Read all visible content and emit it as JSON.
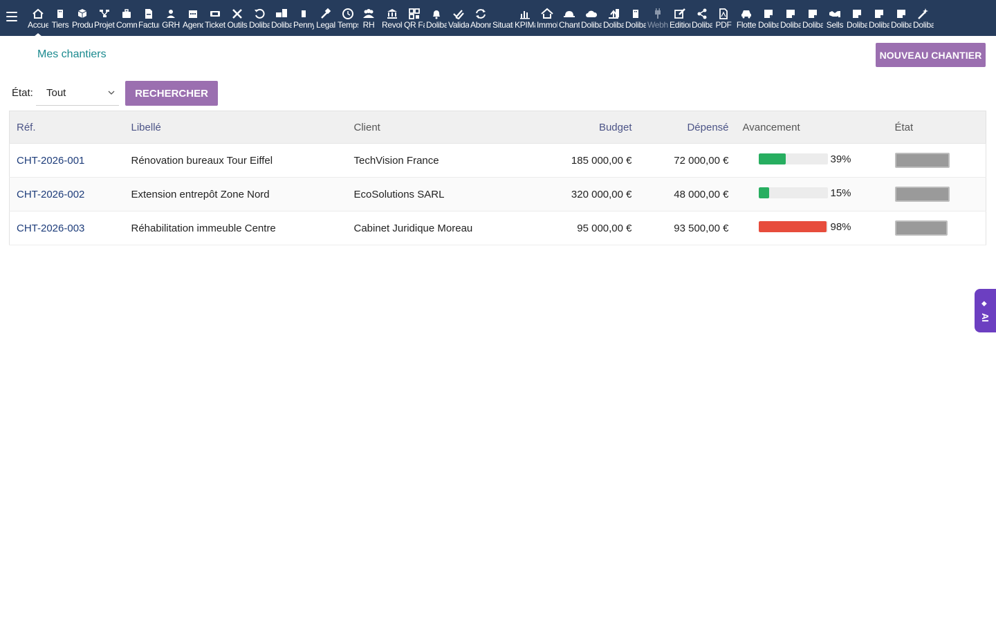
{
  "topbar": {
    "menu": [
      {
        "label": "Accueil",
        "icon": "home-icon"
      },
      {
        "label": "Tiers",
        "icon": "building-icon"
      },
      {
        "label": "Produits",
        "icon": "cube-icon"
      },
      {
        "label": "Projets",
        "icon": "project-icon"
      },
      {
        "label": "Commerce",
        "icon": "briefcase-icon"
      },
      {
        "label": "Facturation",
        "icon": "invoice-icon"
      },
      {
        "label": "GRH",
        "icon": "user-icon"
      },
      {
        "label": "Agenda",
        "icon": "calendar-icon"
      },
      {
        "label": "Tickets",
        "icon": "ticket-icon"
      },
      {
        "label": "Outils",
        "icon": "tools-icon"
      },
      {
        "label": "Dolibarr",
        "icon": "undo-icon"
      },
      {
        "label": "Dolibarr",
        "icon": "briefcase-doc-icon"
      },
      {
        "label": "Penny",
        "icon": "bookmark-icon"
      },
      {
        "label": "Legal",
        "icon": "gavel-icon"
      },
      {
        "label": "Temps",
        "icon": "clock-icon"
      },
      {
        "label": "RH",
        "icon": "users-icon"
      },
      {
        "label": "Revolut",
        "icon": "bank-icon"
      },
      {
        "label": "QR Facture",
        "icon": "qrcode-icon"
      },
      {
        "label": "Dolibarr",
        "icon": "bell-icon"
      },
      {
        "label": "Validation",
        "icon": "check-double-icon"
      },
      {
        "label": "Abonnements",
        "icon": "sync-icon"
      },
      {
        "label": "Situations",
        "icon": "blank-icon"
      },
      {
        "label": "KPIMax",
        "icon": "bar-chart-icon"
      },
      {
        "label": "Immobilier",
        "icon": "house-icon"
      },
      {
        "label": "Chantiers",
        "icon": "hardhat-icon"
      },
      {
        "label": "Dolibarr",
        "icon": "cloud-icon"
      },
      {
        "label": "Dolibarr",
        "icon": "upload-icon"
      },
      {
        "label": "Dolibarr",
        "icon": "building-icon"
      },
      {
        "label": "Webhook",
        "icon": "plug-icon"
      },
      {
        "label": "Edition",
        "icon": "edit-icon"
      },
      {
        "label": "Dolibarr",
        "icon": "share-icon"
      },
      {
        "label": "PDF",
        "icon": "pdf-icon"
      },
      {
        "label": "Flotte",
        "icon": "car-icon"
      },
      {
        "label": "Dolibarr",
        "icon": "note-icon"
      },
      {
        "label": "Dolibarr",
        "icon": "note-icon"
      },
      {
        "label": "Dolibarr",
        "icon": "note-icon"
      },
      {
        "label": "Sells",
        "icon": "handshake-icon"
      },
      {
        "label": "Dolibarr",
        "icon": "note-icon"
      },
      {
        "label": "Dolibarr",
        "icon": "note-icon"
      },
      {
        "label": "Dolibarr",
        "icon": "note-icon"
      },
      {
        "label": "Dolibarr",
        "icon": "magic-icon"
      }
    ]
  },
  "page": {
    "title": "Mes chantiers",
    "new_button": "NOUVEAU CHANTIER"
  },
  "filter": {
    "label": "État:",
    "selected": "Tout",
    "search_button": "RECHERCHER"
  },
  "table": {
    "headers": {
      "ref": "Réf.",
      "libelle": "Libellé",
      "client": "Client",
      "budget": "Budget",
      "depense": "Dépensé",
      "avancement": "Avancement",
      "etat": "État"
    },
    "rows": [
      {
        "ref": "CHT-2026-001",
        "libelle": "Rénovation bureaux Tour Eiffel",
        "client": "TechVision France",
        "budget": "185 000,00 €",
        "depense": "72 000,00 €",
        "progress": 39,
        "progress_label": "39%",
        "progress_color": "#27ae60"
      },
      {
        "ref": "CHT-2026-002",
        "libelle": "Extension entrepôt Zone Nord",
        "client": "EcoSolutions SARL",
        "budget": "320 000,00 €",
        "depense": "48 000,00 €",
        "progress": 15,
        "progress_label": "15%",
        "progress_color": "#27ae60"
      },
      {
        "ref": "CHT-2026-003",
        "libelle": "Réhabilitation immeuble Centre",
        "client": "Cabinet Juridique Moreau",
        "budget": "95 000,00 €",
        "depense": "93 500,00 €",
        "progress": 98,
        "progress_label": "98%",
        "progress_color": "#e74c3c"
      }
    ]
  },
  "ai_tab": {
    "label": "AI",
    "icon": "sparkle-icon"
  },
  "colors": {
    "topbar": "#263c5c",
    "accent": "#9b6fb0",
    "title": "#1b8a8f",
    "link": "#1d3c7a",
    "ai": "#6c3fc1"
  }
}
